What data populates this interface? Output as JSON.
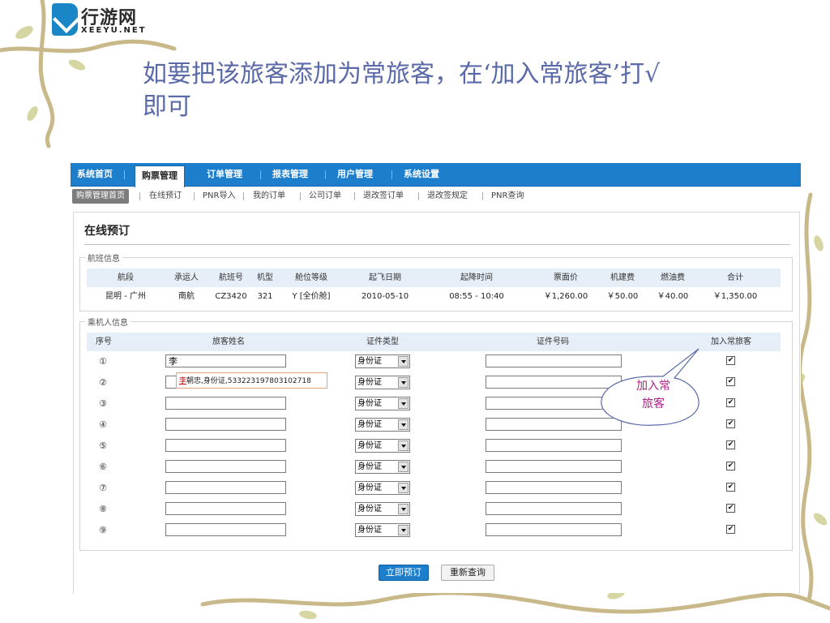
{
  "brand": {
    "name_cn": "行游网",
    "name_en": "XEEYU.NET"
  },
  "slide_title": "如要把该旅客添加为常旅客，在‘加入常旅客’打√即可",
  "topnav": [
    "系统首页",
    "购票管理",
    "订单管理",
    "报表管理",
    "用户管理",
    "系统设置"
  ],
  "topnav_active": "购票管理",
  "subnav": [
    "购票管理首页",
    "在线预订",
    "PNR导入",
    "我的订单",
    "公司订单",
    "退改签订单",
    "退改签规定",
    "PNR查询"
  ],
  "subnav_active": "购票管理首页",
  "panel_title": "在线预订",
  "flight": {
    "legend": "航班信息",
    "headers": [
      "航段",
      "承运人",
      "航班号",
      "机型",
      "舱位等级",
      "起飞日期",
      "起降时间",
      "票面价",
      "机建费",
      "燃油费",
      "合计"
    ],
    "row": [
      "昆明 - 广州",
      "南航",
      "CZ3420",
      "321",
      "Y [全价舱]",
      "2010-05-10",
      "08:55 - 10:40",
      "￥1,260.00",
      "￥50.00",
      "￥40.00",
      "￥1,350.00"
    ]
  },
  "passengers": {
    "legend": "乘机人信息",
    "headers": [
      "序号",
      "旅客姓名",
      "证件类型",
      "证件号码",
      "加入常旅客"
    ],
    "rows": [
      {
        "seq": "①",
        "name": "李",
        "id_type": "身份证",
        "checked": "✔"
      },
      {
        "seq": "②",
        "name": "",
        "id_type": "身份证",
        "checked": "✔"
      },
      {
        "seq": "③",
        "name": "",
        "id_type": "身份证",
        "checked": "✔"
      },
      {
        "seq": "④",
        "name": "",
        "id_type": "身份证",
        "checked": "✔"
      },
      {
        "seq": "⑤",
        "name": "",
        "id_type": "身份证",
        "checked": "✔"
      },
      {
        "seq": "⑥",
        "name": "",
        "id_type": "身份证",
        "checked": "✔"
      },
      {
        "seq": "⑦",
        "name": "",
        "id_type": "身份证",
        "checked": "✔"
      },
      {
        "seq": "⑧",
        "name": "",
        "id_type": "身份证",
        "checked": "✔"
      },
      {
        "seq": "⑨",
        "name": "",
        "id_type": "身份证",
        "checked": "✔"
      }
    ],
    "suggestion": {
      "match": "李",
      "rest": "朝忠,身份证,533223197803102718"
    }
  },
  "buttons": {
    "book": "立即预订",
    "requery": "重新查询"
  },
  "callout": {
    "line1": "加入常",
    "line2": "旅客"
  },
  "colors": {
    "accent": "#1d7fcc",
    "title": "#5a6aa8",
    "callout": "#b0208a",
    "header_bg": "#e6eef7"
  }
}
